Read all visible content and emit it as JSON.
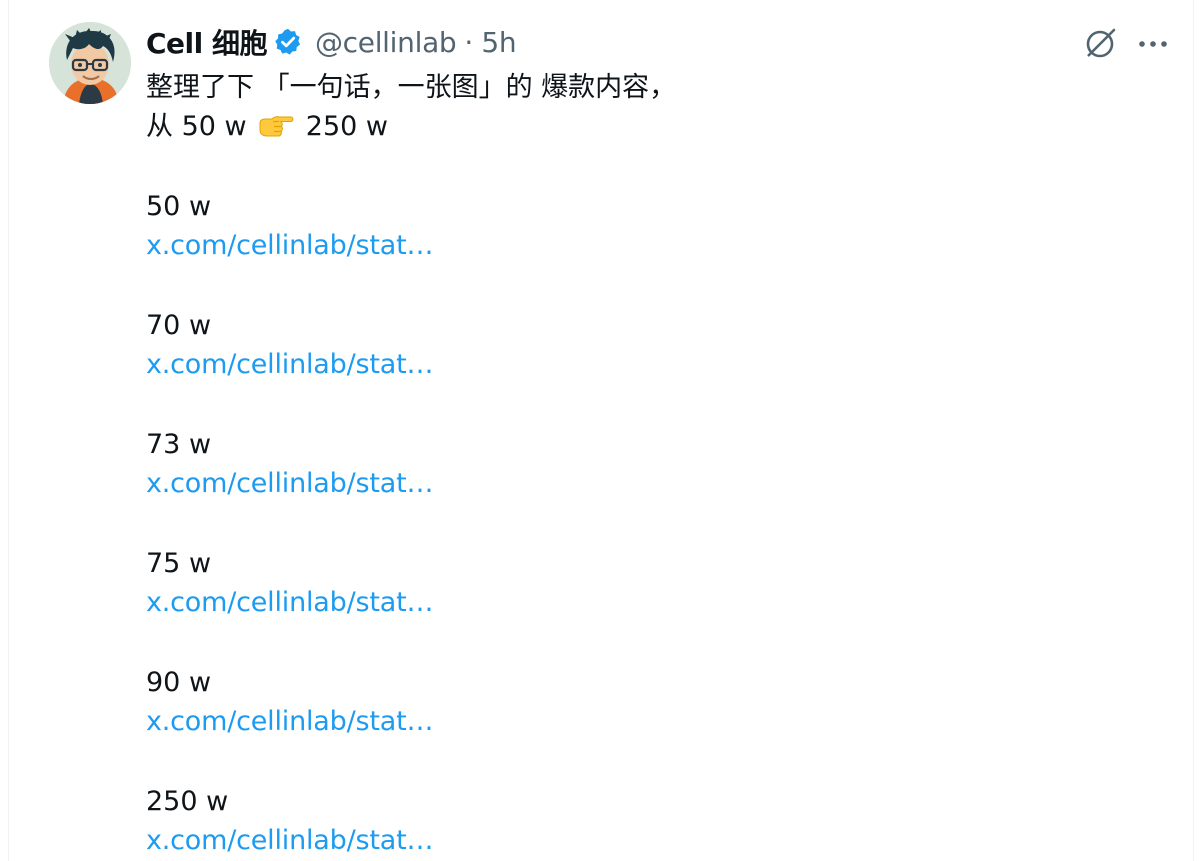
{
  "tweet": {
    "author_name": "Cell 细胞",
    "handle": "@cellinlab",
    "dot": "·",
    "time": "5h",
    "icons": [
      "verified-badge-icon",
      "grok-icon",
      "more-icon",
      "pointing-hand-emoji-icon"
    ],
    "accent_color": "#1d9bf0",
    "intro_line": "整理了下 「一句话，一张图」的 爆款内容，",
    "range_from": "从 50 w",
    "range_to": "250 w",
    "entries": [
      {
        "count": "50 w",
        "link": "x.com/cellinlab/stat…"
      },
      {
        "count": "70 w",
        "link": "x.com/cellinlab/stat…"
      },
      {
        "count": "73 w",
        "link": "x.com/cellinlab/stat…"
      },
      {
        "count": "75 w",
        "link": "x.com/cellinlab/stat…"
      },
      {
        "count": "90 w",
        "link": "x.com/cellinlab/stat…"
      },
      {
        "count": "250 w",
        "link": "x.com/cellinlab/stat…"
      }
    ]
  }
}
